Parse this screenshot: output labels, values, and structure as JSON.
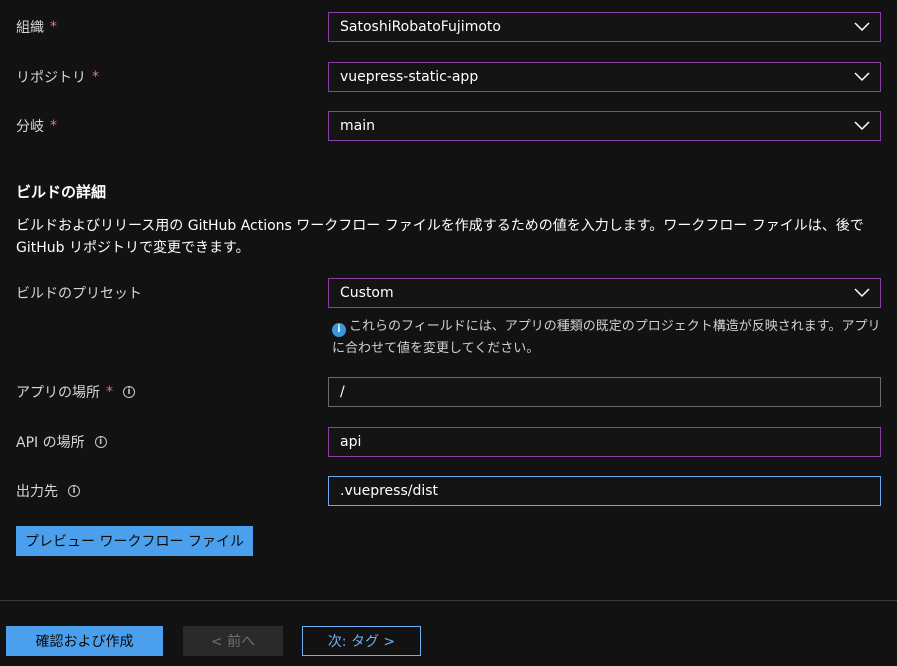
{
  "fields": {
    "org": {
      "label": "組織",
      "required_mark": "*",
      "value": "SatoshiRobatoFujimoto"
    },
    "repo": {
      "label": "リポジトリ",
      "required_mark": "*",
      "value": "vuepress-static-app"
    },
    "branch": {
      "label": "分岐",
      "required_mark": "*",
      "value": "main"
    }
  },
  "build_details": {
    "title": "ビルドの詳細",
    "description": "ビルドおよびリリース用の GitHub Actions ワークフロー ファイルを作成するための値を入力します。ワークフロー ファイルは、後で GitHub リポジトリで変更できます。",
    "preset": {
      "label": "ビルドのプリセット",
      "value": "Custom"
    },
    "preset_note": "これらのフィールドには、アプリの種類の既定のプロジェクト構造が反映されます。アプリに合わせて値を変更してください。",
    "app_location": {
      "label": "アプリの場所",
      "required_mark": "*",
      "value": "/"
    },
    "api_location": {
      "label": "API の場所",
      "value": "api"
    },
    "output_location": {
      "label": "出力先",
      "value": ".vuepress/dist"
    },
    "info_glyph": "i",
    "preview_button": "プレビュー ワークフロー ファイル"
  },
  "footer": {
    "create_button": "確認および作成",
    "prev_button": "< 前へ",
    "next_button": "次: タグ >"
  },
  "colors": {
    "background": "#121212",
    "accent": "#4aa0ec",
    "select_border": "#8a3fa6",
    "required": "#f1707b"
  }
}
